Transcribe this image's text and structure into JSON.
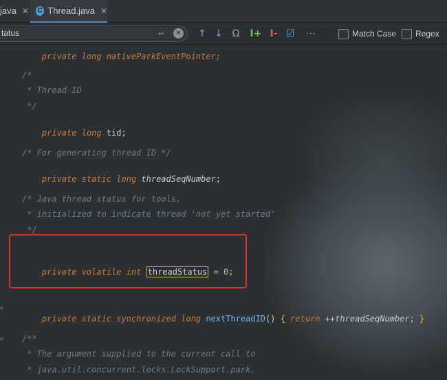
{
  "tabs": [
    {
      "label": "java",
      "close": "✕"
    },
    {
      "label": "Thread.java",
      "close": "✕",
      "icon": "C"
    }
  ],
  "search": {
    "value": "tatus",
    "enter_glyph": "↵",
    "clear_glyph": "✕"
  },
  "toolbar": {
    "prev": "↑",
    "next": "↓",
    "all": "Ω",
    "add": "I+",
    "remove": "I-",
    "select": "☑",
    "more": "⋯",
    "match_case": "Match Case",
    "regex": "Regex"
  },
  "code": {
    "line0": "private long nativeParkEventPointer;",
    "c1a": "/*",
    "c1b": " * Thread ID",
    "c1c": " */",
    "tid_kw": "private long ",
    "tid": "tid;",
    "c2": "/* For generating thread ID */",
    "seq_kw": "private static long ",
    "seq": "threadSeqNumber",
    "seq_end": ";",
    "c3a": "/* Java thread status for tools,",
    "c3b": " * initialized to indicate thread 'not yet started'",
    "c3c": " */",
    "ts_kw1": "private volatile int ",
    "ts": "threadStatus",
    "ts_eq": " = ",
    "ts_num": "0",
    "ts_end": ";",
    "nt_kw": "private static synchronized long ",
    "nt_fn": "nextThreadID",
    "nt_p": "() ",
    "nt_b1": "{ ",
    "nt_ret": "return ",
    "nt_inc": "++",
    "nt_id": "threadSeqNumber",
    "nt_semi": "; ",
    "nt_b2": "}",
    "c4a": "/**",
    "c4b": " * The argument supplied to the current call to",
    "c4c": " * java.util.concurrent.locks.LockSupport.park."
  }
}
